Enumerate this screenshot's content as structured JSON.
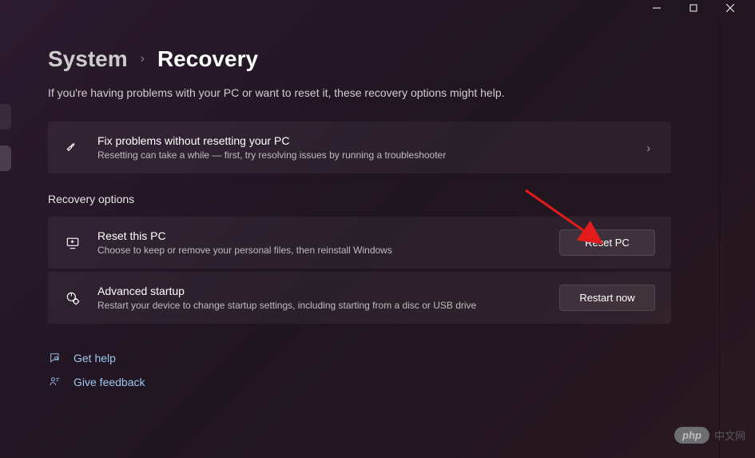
{
  "breadcrumb": {
    "parent": "System",
    "current": "Recovery"
  },
  "subtitle": "If you're having problems with your PC or want to reset it, these recovery options might help.",
  "troubleshoot": {
    "title": "Fix problems without resetting your PC",
    "desc": "Resetting can take a while — first, try resolving issues by running a troubleshooter"
  },
  "section_header": "Recovery options",
  "reset": {
    "title": "Reset this PC",
    "desc": "Choose to keep or remove your personal files, then reinstall Windows",
    "button": "Reset PC"
  },
  "advanced": {
    "title": "Advanced startup",
    "desc": "Restart your device to change startup settings, including starting from a disc or USB drive",
    "button": "Restart now"
  },
  "help_link": "Get help",
  "feedback_link": "Give feedback",
  "watermark": {
    "badge": "php",
    "text": "中文网"
  }
}
